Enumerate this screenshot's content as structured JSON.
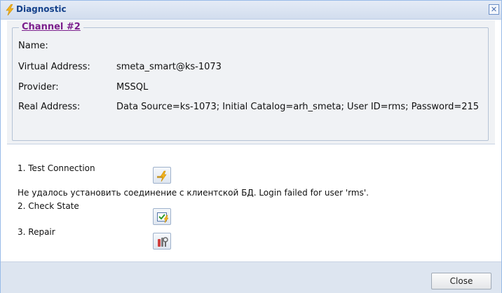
{
  "window": {
    "title": "Diagnostic",
    "title_icon": "lightning-icon",
    "close_icon": "close-icon"
  },
  "channel": {
    "legend": "Channel #2",
    "fields": [
      {
        "label": "Name:",
        "value": ""
      },
      {
        "label": "Virtual Address:",
        "value": "smeta_smart@ks-1073"
      },
      {
        "label": "Provider:",
        "value": "MSSQL"
      },
      {
        "label": "Real Address:",
        "value": "Data Source=ks-1073; Initial Catalog=arh_smeta; User ID=rms; Password=215"
      }
    ]
  },
  "actions": [
    {
      "label": "1. Test Connection",
      "icon": "test-connection-icon"
    },
    {
      "label": "2. Check State",
      "icon": "check-state-icon"
    },
    {
      "label": "3. Repair",
      "icon": "repair-icon"
    }
  ],
  "error_message": "Не удалось установить соединение с клиентской БД. Login failed for user 'rms'.",
  "footer": {
    "close_label": "Close"
  },
  "colors": {
    "title_text": "#15428b",
    "legend_text": "#7b1e8c",
    "panel_bg": "#f0f2f5",
    "footer_bg": "#dde5f0"
  }
}
